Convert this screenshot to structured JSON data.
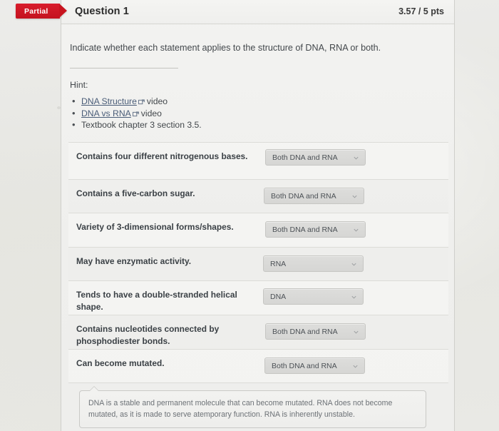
{
  "header": {
    "badge_label": "Partial",
    "title": "Question 1",
    "score": "3.57 / 5 pts",
    "badge_color": "#c8141f"
  },
  "prompt": "Indicate whether each statement applies to the structure of DNA, RNA or both.",
  "hint": {
    "label": "Hint:",
    "items": [
      {
        "link_text": "DNA Structure",
        "icon": "external-link-icon",
        "suffix": "video"
      },
      {
        "link_text": "DNA vs RNA",
        "icon": "external-link-icon",
        "suffix": "video"
      },
      {
        "link_text": "",
        "icon": "",
        "suffix": "Textbook chapter 3 section 3.5."
      }
    ],
    "link_color": "#4a5d78"
  },
  "answer_options": [
    "DNA",
    "RNA",
    "Both DNA and RNA"
  ],
  "rows": [
    {
      "statement": "Contains four different nitrogenous bases.",
      "answer": "Both DNA and RNA"
    },
    {
      "statement": "Contains a five-carbon sugar.",
      "answer": "Both DNA and RNA"
    },
    {
      "statement": "Variety of 3-dimensional forms/shapes.",
      "answer": "Both DNA and RNA"
    },
    {
      "statement": "May have enzymatic activity.",
      "answer": "RNA"
    },
    {
      "statement": "Tends to have a double-stranded helical shape.",
      "answer": "DNA"
    },
    {
      "statement": "Contains nucleotides connected by phosphodiester bonds.",
      "answer": "Both DNA and RNA"
    },
    {
      "statement": "Can become mutated.",
      "answer": "Both DNA and RNA"
    }
  ],
  "comment": "DNA is a stable and permanent molecule that can become mutated. RNA does not become mutated, as it is made to serve atemporary function. RNA is inherently unstable."
}
